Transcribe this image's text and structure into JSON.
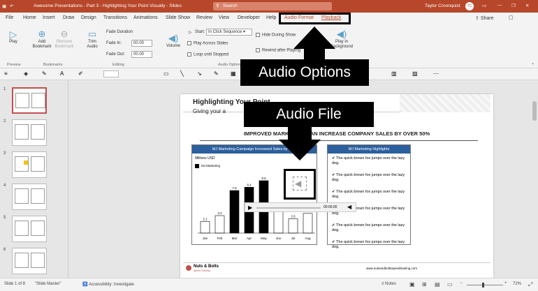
{
  "titlebar": {
    "doc_title": "Awesome Presentations - Part 3 - Highlighting Your Point Visually - Slides",
    "search_placeholder": "Search",
    "user": "Taylor Croonquist",
    "initials": "TC"
  },
  "tabs": [
    "File",
    "Home",
    "Insert",
    "Draw",
    "Design",
    "Transitions",
    "Animations",
    "Slide Show",
    "Review",
    "View",
    "Developer",
    "Help",
    "Audio Format",
    "Playback"
  ],
  "share_label": "Share",
  "ribbon": {
    "play_label": "Play",
    "add_bookmark": "Add Bookmark",
    "remove_bookmark": "Remove Bookmark",
    "trim_audio": "Trim Audio",
    "fade_duration": "Fade Duration",
    "fade_in_label": "Fade In:",
    "fade_in_value": "00.00",
    "fade_out_label": "Fade Out:",
    "fade_out_value": "00.00",
    "volume": "Volume",
    "start_label": "Start:",
    "start_value": "In Click Sequence",
    "play_across": "Play Across Slides",
    "loop": "Loop until Stopped",
    "hide_during": "Hide During Show",
    "rewind": "Rewind after Playing",
    "play_bg": "Play in Background",
    "groups": [
      "Preview",
      "Bookmarks",
      "Editing",
      "Audio Options"
    ]
  },
  "callouts": {
    "audio_options": "Audio Options",
    "audio_file": "Audio File"
  },
  "slide": {
    "title": "Highlighting Your Point",
    "subtitle": "Giving your a",
    "headline": "IMPROVED MARKETING CAN INCREASE COMPANY SALES BY OVER 50%",
    "chart_title": "MJ Marketing Campaign Increased Sales by 50%",
    "units": "Millions USD",
    "legend": "MJ Marketing",
    "highlights_title": "MJ Marketing Highlights",
    "bullets": [
      "The quick brown fox jumps over the lazy dog.",
      "The quick brown fox jumps over the lazy dog.",
      "The quick brown fox jumps over the lazy dog.",
      "The quick brown fox jumps over the lazy dog.",
      "The quick brown fox jumps over the lazy dog.",
      "The quick brown fox jumps over the lazy dog."
    ],
    "player_time": "00:00.00",
    "footer_logo": "Nuts & Bolts",
    "footer_logo_sub": "Speed Training",
    "footer_url": "www.nutsandboltsspeedtraining.com"
  },
  "chart_data": {
    "type": "bar",
    "categories": [
      "Jan",
      "Feb",
      "Mar",
      "Apr",
      "May",
      "Jun",
      "Jul",
      "Aug"
    ],
    "values": [
      2.1,
      3.2,
      7.8,
      8.4,
      9.6,
      3.9,
      2.6,
      3.6
    ],
    "highlighted": [
      false,
      false,
      true,
      true,
      true,
      false,
      false,
      false
    ],
    "ylim": [
      0,
      11
    ]
  },
  "thumb_numbers": [
    "1",
    "2",
    "3",
    "4",
    "5",
    "6"
  ],
  "status": {
    "slide": "Slide 1 of 8",
    "master": "\"Slide Master\"",
    "accessibility": "Accessibility: Investigate",
    "notes": "Notes",
    "zoom": "72%"
  }
}
